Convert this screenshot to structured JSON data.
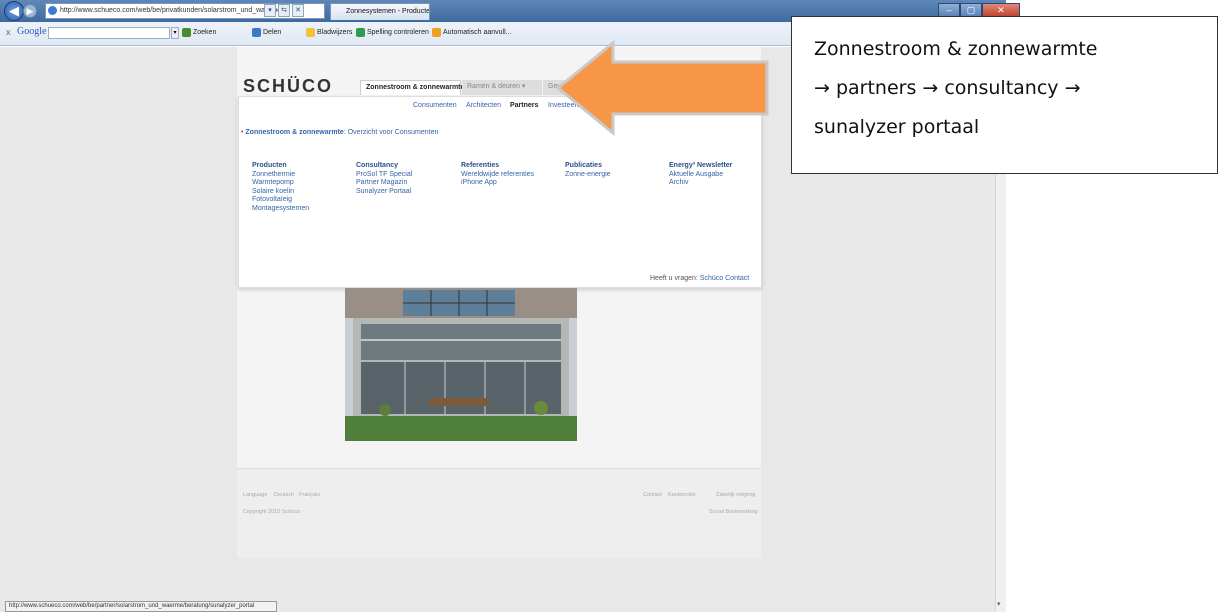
{
  "browser": {
    "address": "http://www.schueco.com/web/be/privatkunden/solarstrom_und_waerme/",
    "tab_title": "Zonnesystemen - Producten -...",
    "window_buttons": [
      "–",
      "▢",
      "✕"
    ],
    "address_buttons": [
      "▾",
      "⇆",
      "✕"
    ],
    "google_label": "Google",
    "toolbar_items": [
      "Zoeken",
      "Delen",
      "Bladwijzers",
      "Spelling controleren",
      "Automatisch aanvull..."
    ],
    "toolbar_close": "x"
  },
  "site": {
    "logo": "SCHÜCO",
    "nav": [
      "Zonnestroom & zonnewarmte",
      "Ramen & deuren",
      "Gevel"
    ],
    "subnav": [
      "Consumenten",
      "Architecten",
      "Partners",
      "Investeerders"
    ],
    "breadcrumb_bold": "Zonnestroom & zonnewarmte",
    "breadcrumb_rest": ": Overzicht voor Consumenten",
    "columns": [
      {
        "heading": "Producten",
        "items": [
          "Zonnethermie",
          "Warmtepomp",
          "Solaire koelin",
          "Fotovoltaïeig",
          "Montagesystemen"
        ]
      },
      {
        "heading": "Consultancy",
        "items": [
          "ProSol TF Special",
          "Partner Magazin",
          "Sunalyzer Portaal"
        ]
      },
      {
        "heading": "Referenties",
        "items": [
          "Wereldwijde referenties",
          "iPhone App"
        ]
      },
      {
        "heading": "Publicaties",
        "items": [
          "Zonne-energie"
        ]
      },
      {
        "heading": "Energy³ Newsletter",
        "items": [
          "Aktuelle Ausgabe",
          "Archiv"
        ]
      }
    ],
    "contact_prefix": "Heeft u vragen:",
    "contact_link": "Schüco Contact",
    "footer": {
      "language": "Language",
      "lang1": "Deutsch",
      "lang2": "Français",
      "contact": "Contact",
      "sitemap": "Kantoorsite",
      "imprint": "Zakelijk volgeng",
      "copyright": "Copyright 2010 Schüco",
      "social": "Social Bookmarking"
    }
  },
  "status_bar": "http://www.schueco.com/web/be/partner/solarstrom_und_waerme/beratung/sunalyzer_portal",
  "annotation": {
    "line1": "Zonnestroom & zonnewarmte",
    "line2": "→ partners → consultancy →",
    "line3": "sunalyzer portaal",
    "arrow_color": "#f79646"
  }
}
